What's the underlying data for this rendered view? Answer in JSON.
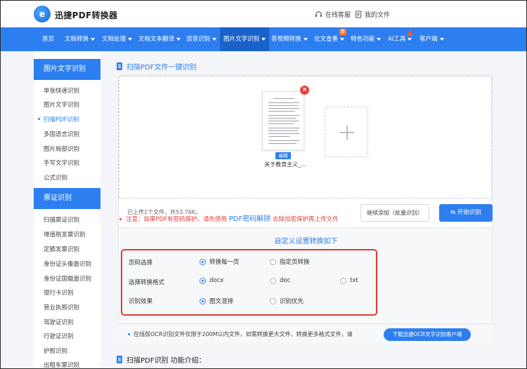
{
  "header": {
    "logo_glyph": "e",
    "brand": "迅捷PDF转换器",
    "service_label": "在线客服",
    "my_files_label": "我的文件"
  },
  "nav": {
    "items": [
      {
        "label": "首页",
        "dropdown": false
      },
      {
        "label": "文档转换",
        "dropdown": true
      },
      {
        "label": "文档处理",
        "dropdown": true
      },
      {
        "label": "文档文本翻译",
        "dropdown": true
      },
      {
        "label": "语音识别",
        "dropdown": true
      },
      {
        "label": "图片文字识别",
        "dropdown": true,
        "active": true
      },
      {
        "label": "音视频转换",
        "dropdown": true
      },
      {
        "label": "论文查重",
        "dropdown": true,
        "badge": "新"
      },
      {
        "label": "特色功能",
        "dropdown": true
      },
      {
        "label": "AI工具",
        "dropdown": true,
        "hot": true
      },
      {
        "label": "客户端",
        "dropdown": true
      }
    ],
    "accent": "#2d7ff0"
  },
  "sidebar": {
    "groups": [
      {
        "title": "图片文字识别",
        "items": [
          "单张快速识别",
          "图片文字识别",
          "扫描PDF识别",
          "多国语言识别",
          "图片局部识别",
          "手写文字识别",
          "公式识别"
        ],
        "active_index": 2
      },
      {
        "title": "票证识别",
        "items": [
          "扫描票证识别",
          "增值税发票识别",
          "定额发票识别",
          "身份证头像面识别",
          "身份证国徽面识别",
          "银行卡识别",
          "营业执照识别",
          "驾驶证识别",
          "行驶证识别",
          "护照识别",
          "出租车票识别"
        ]
      }
    ]
  },
  "main": {
    "section_title": "扫描PDF文件一键识别",
    "file": {
      "name": "关于教育主义_...",
      "edit_label": "编辑",
      "remove_glyph": "×"
    },
    "upload_status": "已上传1个文件，共53.76K。",
    "continue_button": "继续添加（批量识别）",
    "start_button": "开始识别",
    "notice": {
      "prefix": "注意：如果PDF有密码保护，请先使用",
      "link": "PDF密码解除",
      "suffix": "去除加密保护再上传文件"
    },
    "settings": {
      "title": "自定义设置转换如下",
      "rows": [
        {
          "label": "页码选择",
          "options": [
            "转换每一页",
            "指定页转换"
          ],
          "selected": 0
        },
        {
          "label": "选择转换格式",
          "options": [
            "docx",
            "doc",
            "txt"
          ],
          "selected": 0
        },
        {
          "label": "识别效果",
          "options": [
            "图文混排",
            "识别优先"
          ],
          "selected": 0
        }
      ]
    },
    "info": {
      "text": "在线版OCR识别文件仅限于200M以内文件，如需转换更大文件、转换更多格式文件，请",
      "button": "下载迅捷OCR文字识别客户端"
    },
    "intro_title": "扫描PDF识别 功能介绍："
  },
  "colors": {
    "accent": "#2d7ff0",
    "warning": "#e8413a",
    "highlight_box": "#e0392f"
  }
}
